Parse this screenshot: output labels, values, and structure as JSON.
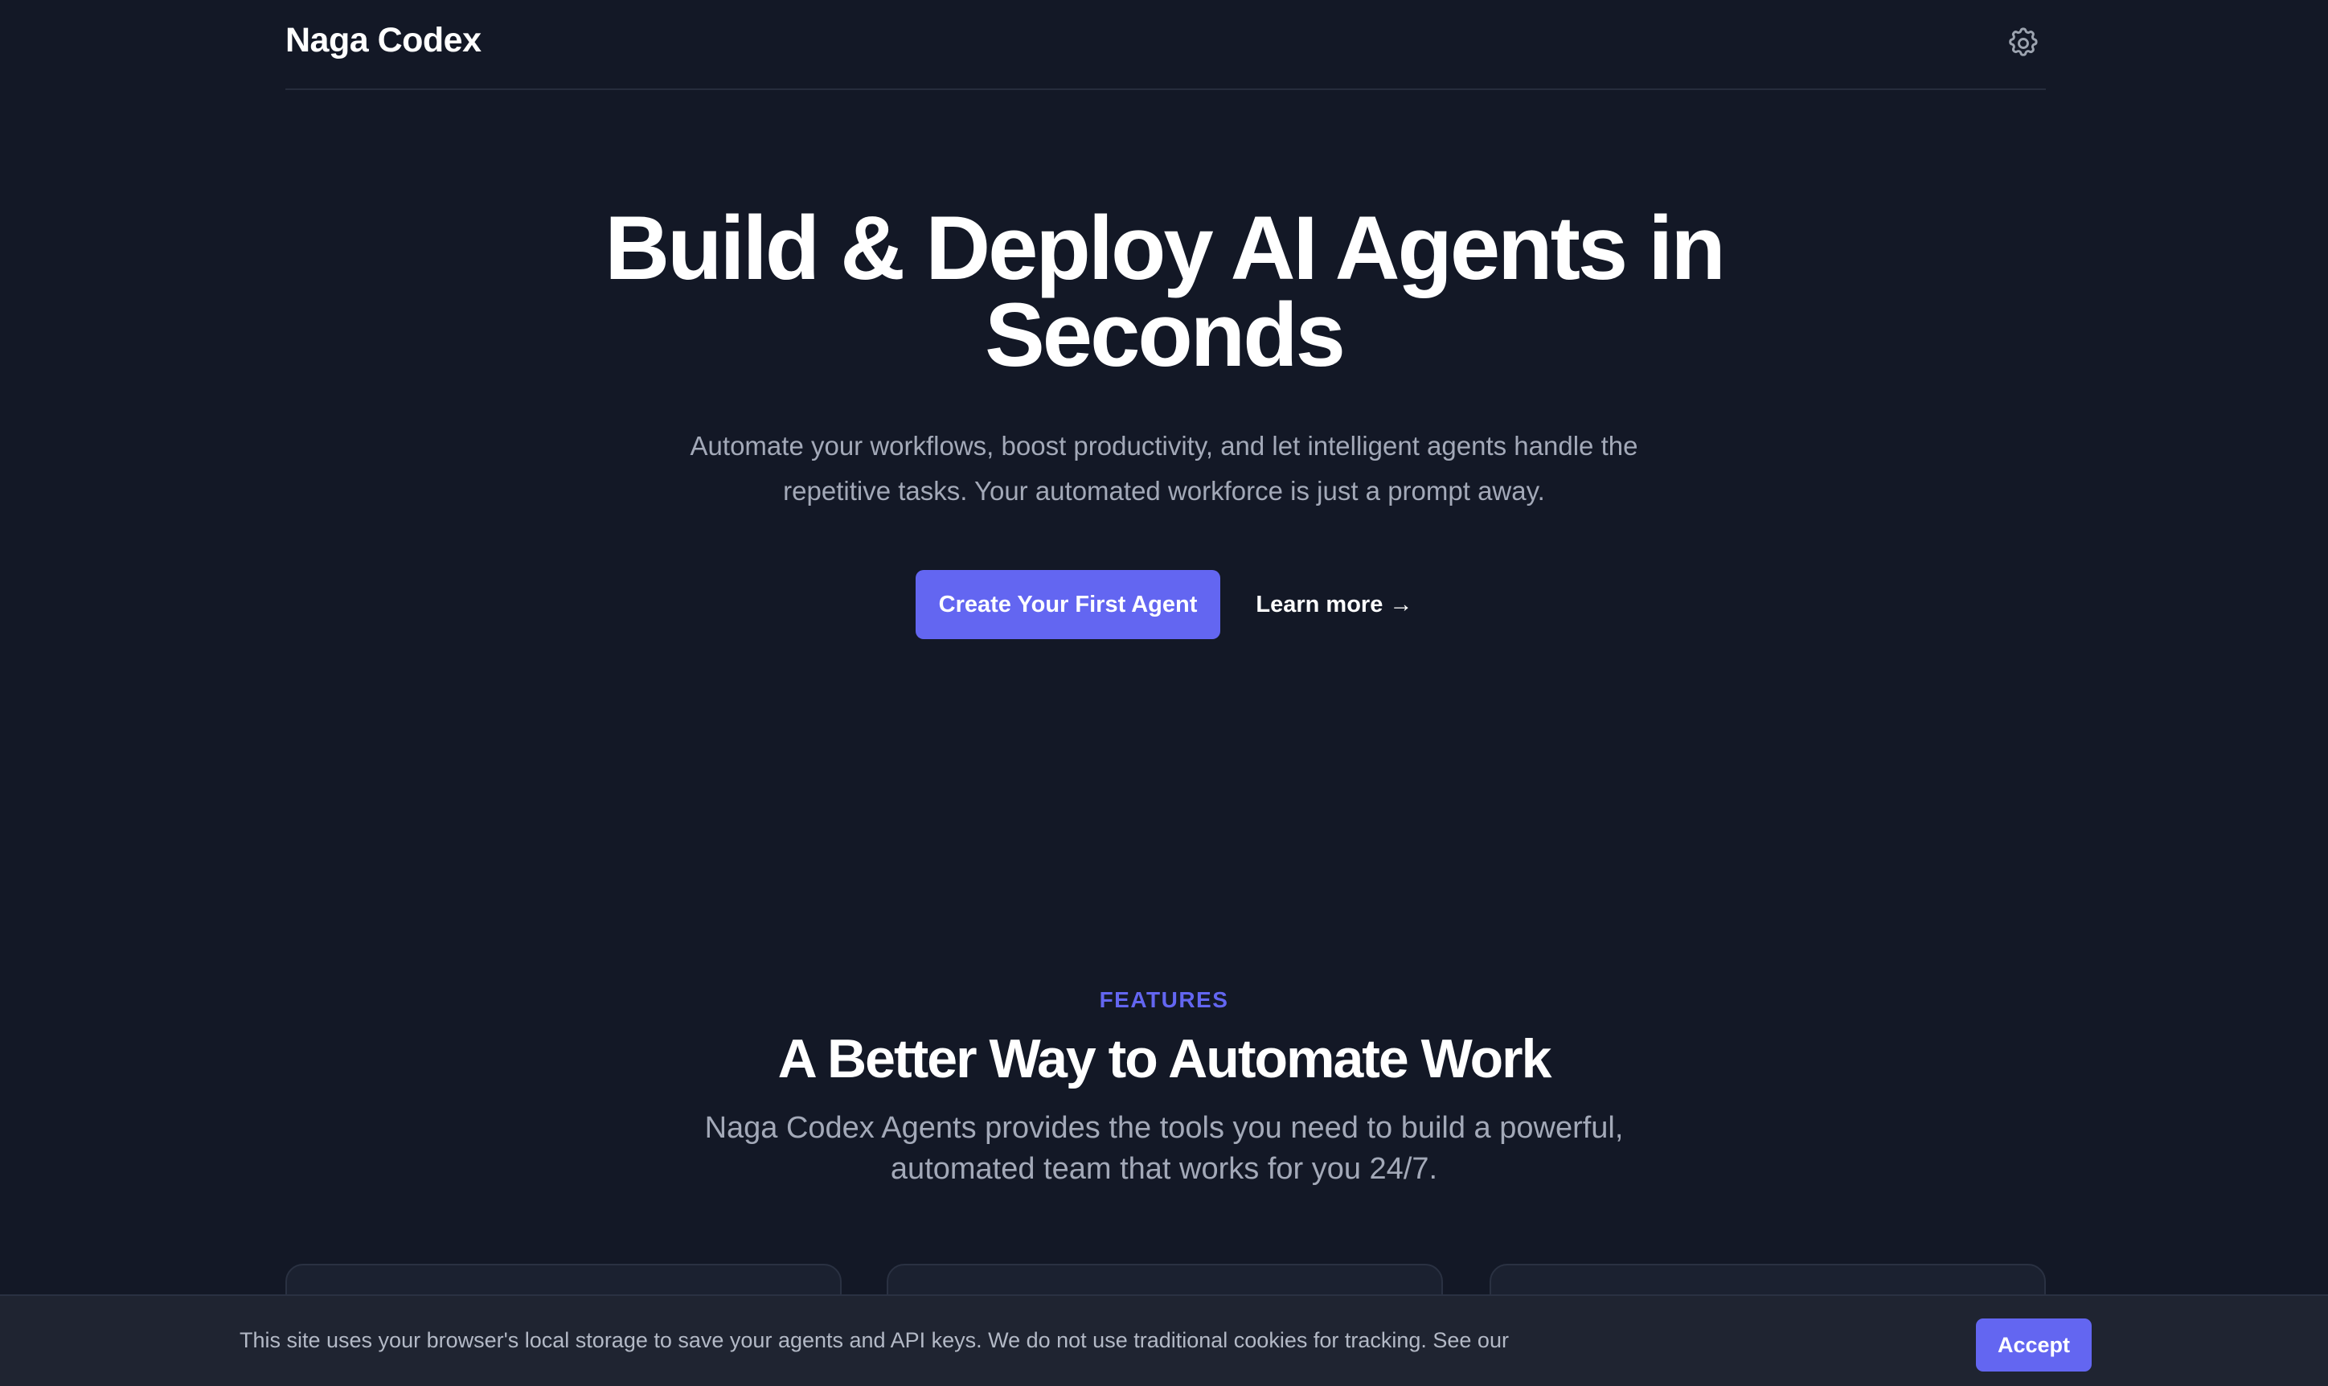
{
  "header": {
    "brand": "Naga Codex",
    "settings_icon": "gear-icon"
  },
  "hero": {
    "title": "Build & Deploy AI Agents in Seconds",
    "subtitle": "Automate your workflows, boost productivity, and let intelligent agents handle the repetitive tasks. Your automated workforce is just a prompt away.",
    "primary_cta": "Create Your First Agent",
    "secondary_cta": "Learn more →"
  },
  "features": {
    "eyebrow": "FEATURES",
    "title": "A Better Way to Automate Work",
    "subtitle": "Naga Codex Agents provides the tools you need to build a powerful, automated team that works for you 24/7."
  },
  "cookie_banner": {
    "text": "This site uses your browser's local storage to save your agents and API keys. We do not use traditional cookies for tracking. See our",
    "accept_label": "Accept"
  },
  "colors": {
    "background": "#131826",
    "accent": "#6366f1",
    "muted_text": "#a3a9b8",
    "banner_bg": "#1f2431"
  }
}
